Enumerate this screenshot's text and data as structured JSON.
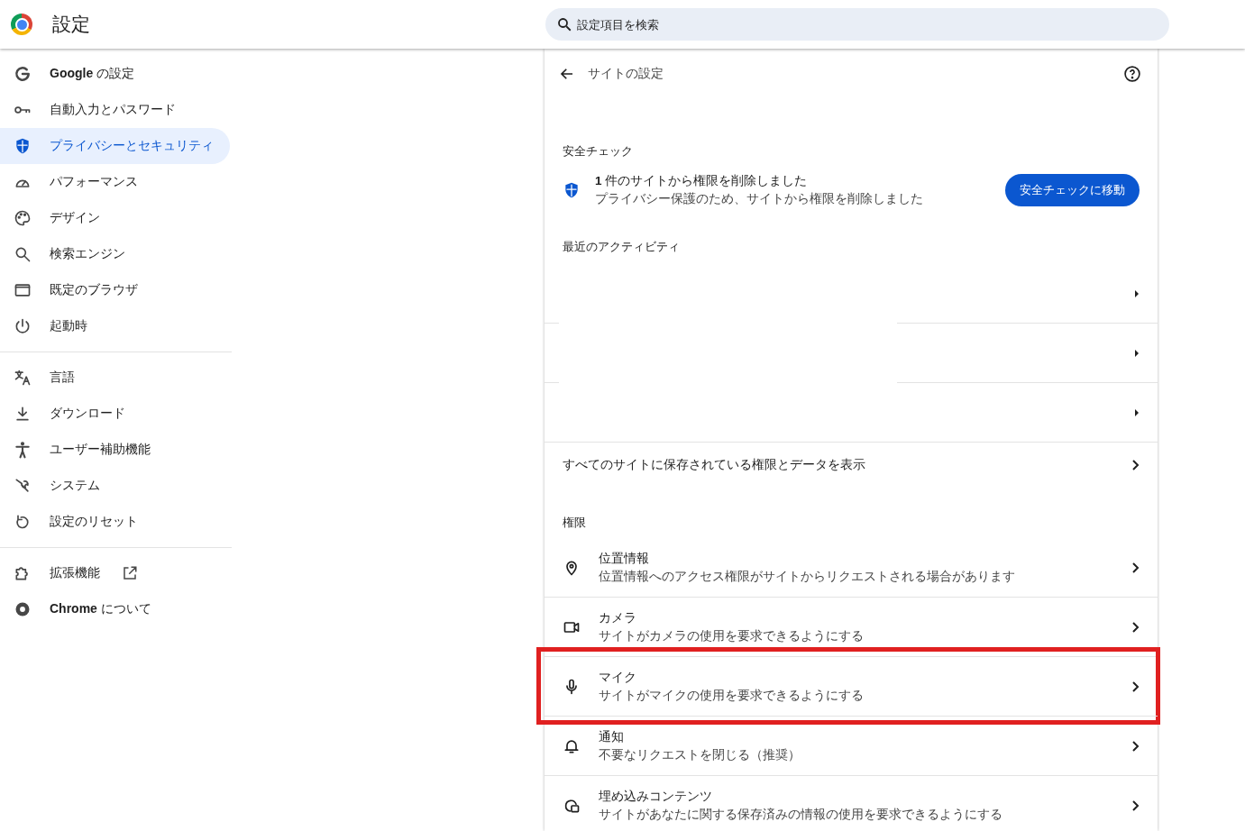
{
  "header": {
    "title": "設定",
    "search": {
      "placeholder": "設定項目を検索"
    }
  },
  "sidebar": {
    "groups": [
      {
        "items": [
          {
            "kind": "google",
            "label": "**Google** の設定",
            "selected": false
          },
          {
            "kind": "key",
            "label": "自動入力とパスワード",
            "selected": false
          },
          {
            "kind": "shield",
            "label": "プライバシーとセキュリティ",
            "selected": true
          },
          {
            "kind": "gauge",
            "label": "パフォーマンス",
            "selected": false
          },
          {
            "kind": "palette",
            "label": "デザイン",
            "selected": false
          },
          {
            "kind": "search",
            "label": "検索エンジン",
            "selected": false
          },
          {
            "kind": "browser",
            "label": "既定のブラウザ",
            "selected": false
          },
          {
            "kind": "power",
            "label": "起動時",
            "selected": false
          }
        ]
      },
      {
        "items": [
          {
            "kind": "translate",
            "label": "言語",
            "selected": false
          },
          {
            "kind": "download",
            "label": "ダウンロード",
            "selected": false
          },
          {
            "kind": "accessibility",
            "label": "ユーザー補助機能",
            "selected": false
          },
          {
            "kind": "wrench",
            "label": "システム",
            "selected": false
          },
          {
            "kind": "reset",
            "label": "設定のリセット",
            "selected": false
          }
        ]
      },
      {
        "items": [
          {
            "kind": "puzzle",
            "label": "拡張機能",
            "selected": false,
            "external": true
          },
          {
            "kind": "chrome",
            "label": "**Chrome** について",
            "selected": false
          }
        ]
      }
    ]
  },
  "page": {
    "title": "サイトの設定",
    "safety_check": {
      "heading": "安全チェック",
      "title": "**1** 件のサイトから権限を削除しました",
      "description": "プライバシー保護のため、サイトから権限を削除しました",
      "button": "安全チェックに移動"
    },
    "recent_activity": {
      "heading": "最近のアクティビティ",
      "rows": [
        {
          "kind": "hidden"
        },
        {
          "kind": "hidden"
        },
        {
          "kind": "hidden"
        }
      ]
    },
    "all_sites": "すべてのサイトに保存されている権限とデータを表示",
    "permissions": {
      "heading": "権限",
      "items": [
        {
          "kind": "location",
          "title": "位置情報",
          "description": "位置情報へのアクセス権限がサイトからリクエストされる場合があります",
          "highlighted": false
        },
        {
          "kind": "camera",
          "title": "カメラ",
          "description": "サイトがカメラの使用を要求できるようにする",
          "highlighted": false
        },
        {
          "kind": "mic",
          "title": "マイク",
          "description": "サイトがマイクの使用を要求できるようにする",
          "highlighted": true
        },
        {
          "kind": "bell",
          "title": "通知",
          "description": "不要なリクエストを閉じる（推奨）",
          "highlighted": false
        },
        {
          "kind": "embedded",
          "title": "埋め込みコンテンツ",
          "description": "サイトがあなたに関する保存済みの情報の使用を要求できるようにする",
          "highlighted": false
        }
      ]
    }
  }
}
